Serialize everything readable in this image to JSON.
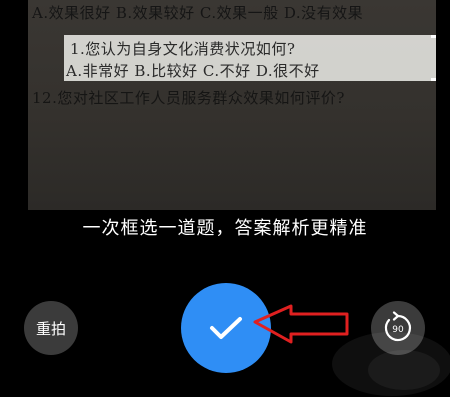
{
  "preview": {
    "line_top": "A.效果很好  B.效果较好  C.效果一般  D.没有效果",
    "question_1": "1.您认为自身文化消费状况如何?",
    "options_1": "A.非常好   B.比较好   C.不好   D.很不好",
    "question_12": "12.您对社区工作人员服务群众效果如何评价?"
  },
  "hint": "一次框选一道题，答案解析更精准",
  "buttons": {
    "retake_label": "重拍",
    "rotate_badge": "90"
  },
  "colors": {
    "accent": "#2f8ef5",
    "arrow": "#e02020",
    "background": "#000000"
  },
  "icons": {
    "confirm": "checkmark-icon",
    "rotate": "rotate-90-icon",
    "annotation": "red-arrow-icon"
  }
}
